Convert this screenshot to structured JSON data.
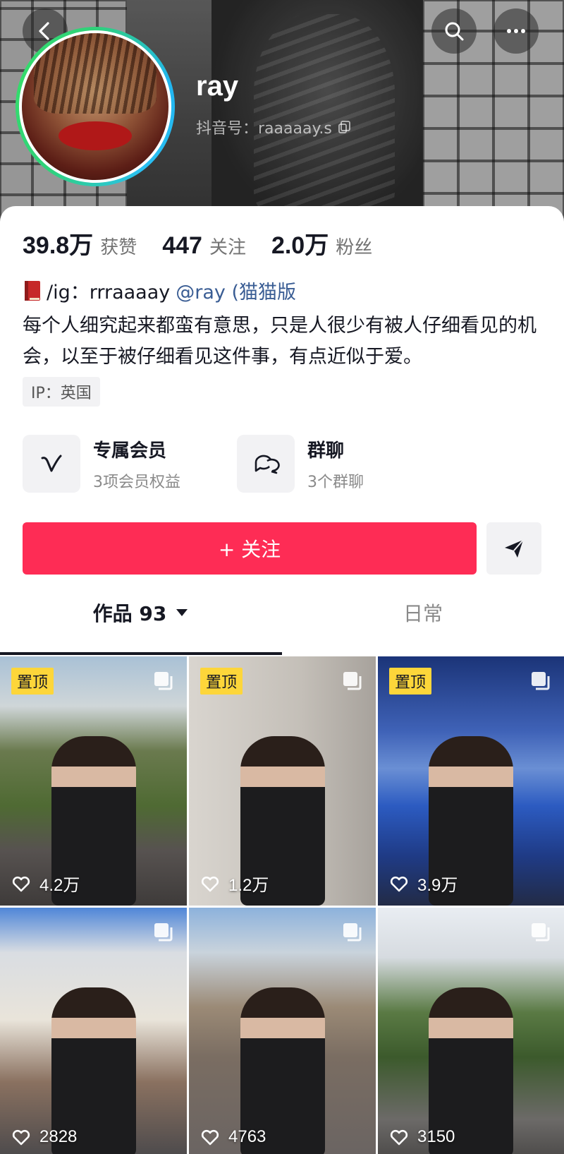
{
  "header": {
    "nickname": "ray",
    "douyin_id": "抖音号：raaaaay.s"
  },
  "stats": [
    {
      "value": "39.8万",
      "label": "获赞"
    },
    {
      "value": "447",
      "label": "关注"
    },
    {
      "value": "2.0万",
      "label": "粉丝"
    }
  ],
  "bio": {
    "line1": "/ig：rrraaaay",
    "mention": "@ray (猫猫版",
    "text": "每个人细究起来都蛮有意思，只是人很少有被人仔细看见的机会，以至于被仔细看见这件事，有点近似于爱。",
    "ip": "IP：英国"
  },
  "features": {
    "member_title": "专属会员",
    "member_sub": "3项会员权益",
    "group_title": "群聊",
    "group_sub": "3个群聊"
  },
  "actions": {
    "follow_label": "+ 关注"
  },
  "tabs": {
    "works": "作品 93",
    "daily": "日常"
  },
  "grid": {
    "pin_label": "置顶",
    "likes": [
      "4.2万",
      "1.2万",
      "3.9万",
      "2828",
      "4763",
      "3150"
    ]
  },
  "colors": {
    "accent": "#fe2c55",
    "pin_badge": "#fdd63a",
    "mention": "#3a5d94",
    "avatar_ring": "#2fd27a"
  },
  "icons": [
    "back-icon",
    "search-icon",
    "more-icon",
    "copy-icon",
    "book-icon",
    "member-v-icon",
    "group-chat-icon",
    "share-send-icon",
    "caret-down-icon",
    "heart-icon",
    "multi-image-icon"
  ]
}
